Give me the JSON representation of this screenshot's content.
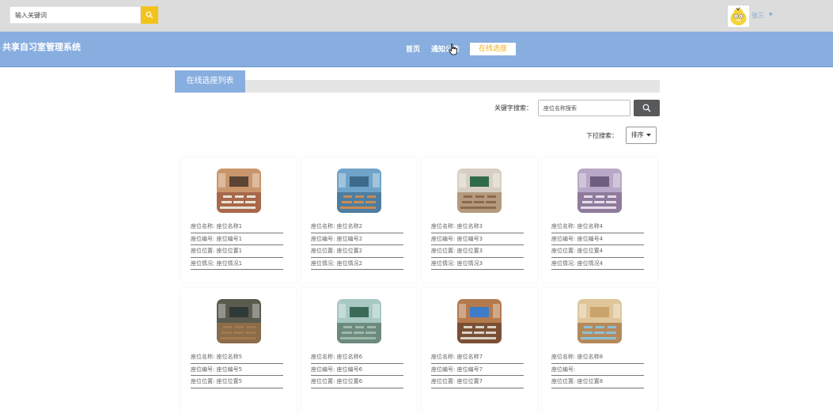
{
  "topbar": {
    "search_placeholder": "输入关键词",
    "username": "张三",
    "caret": "▼"
  },
  "nav": {
    "brand": "共享自习室管理系统",
    "items": [
      "首页",
      "通知公告",
      "在线选座"
    ]
  },
  "section": {
    "title": "在线选座列表",
    "keyword_label": "关键字搜索：",
    "keyword_placeholder": "座位名称搜索",
    "dropdown_label": "下拉搜索：",
    "sort_label": "排序"
  },
  "cards": [
    {
      "fields": [
        "座位名称: 座位名称1",
        "座位编号: 座位编号1",
        "座位位置: 座位位置1",
        "座位情况: 座位情况1"
      ]
    },
    {
      "fields": [
        "座位名称: 座位名称2",
        "座位编号: 座位编号2",
        "座位位置: 座位位置2",
        "座位情况: 座位情况2"
      ]
    },
    {
      "fields": [
        "座位名称: 座位名称3",
        "座位编号: 座位编号3",
        "座位位置: 座位位置3",
        "座位情况: 座位情况3"
      ]
    },
    {
      "fields": [
        "座位名称: 座位名称4",
        "座位编号: 座位编号4",
        "座位位置: 座位位置4",
        "座位情况: 座位情况4"
      ]
    },
    {
      "fields": [
        "座位名称: 座位名称5",
        "座位编号: 座位编号5",
        "座位位置: 座位位置5"
      ]
    },
    {
      "fields": [
        "座位名称: 座位名称6",
        "座位编号: 座位编号6",
        "座位位置: 座位位置6"
      ]
    },
    {
      "fields": [
        "座位名称: 座位名称7",
        "座位编号: 座位编号7",
        "座位位置: 座位位置7"
      ]
    },
    {
      "fields": [
        "座位名称: 座位名称8",
        "座位编号:",
        "座位位置: 座位位置8"
      ]
    }
  ],
  "colors": {
    "accent_blue": "#88aedf",
    "accent_yellow": "#f2c31a",
    "search_button_dark": "#58595b"
  }
}
